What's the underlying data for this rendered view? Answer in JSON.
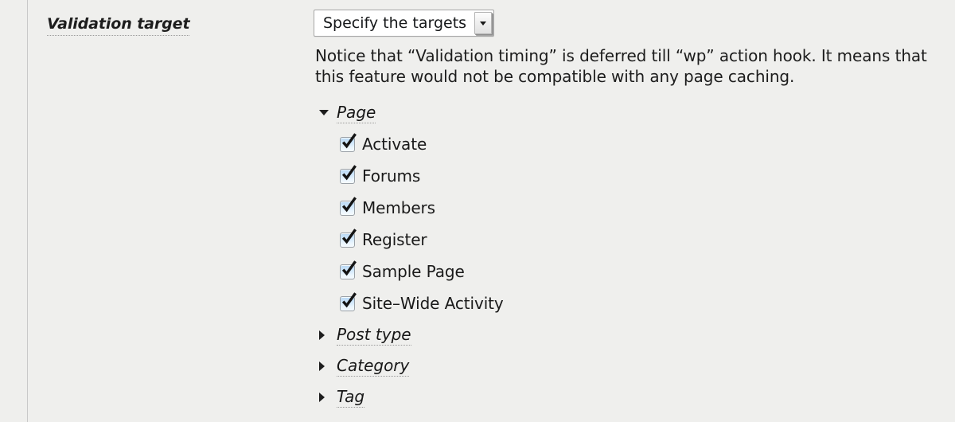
{
  "field": {
    "label": "Validation target",
    "select": {
      "value": "Specify the targets",
      "arrow_icon": "chevron-down-icon"
    },
    "notice": "Notice that “Validation timing” is deferred till “wp” action hook. It means that this feature would not be compatible with any page caching."
  },
  "tree": {
    "groups": [
      {
        "name": "Page",
        "expanded": true,
        "toggle_icon": "triangle-down-icon",
        "items": [
          {
            "label": "Activate",
            "checked": true
          },
          {
            "label": "Forums",
            "checked": true
          },
          {
            "label": "Members",
            "checked": true
          },
          {
            "label": "Register",
            "checked": true
          },
          {
            "label": "Sample Page",
            "checked": true
          },
          {
            "label": "Site–Wide Activity",
            "checked": true
          }
        ]
      },
      {
        "name": "Post type",
        "expanded": false,
        "toggle_icon": "triangle-right-icon",
        "items": []
      },
      {
        "name": "Category",
        "expanded": false,
        "toggle_icon": "triangle-right-icon",
        "items": []
      },
      {
        "name": "Tag",
        "expanded": false,
        "toggle_icon": "triangle-right-icon",
        "items": []
      }
    ]
  },
  "colors": {
    "page_background": "#efefed",
    "divider": "#c9c9c9",
    "text": "#1a1a1a",
    "checkbox_fill": "#cde6fb",
    "checkbox_border": "#9aa0a6",
    "checkmark": "#141414"
  }
}
